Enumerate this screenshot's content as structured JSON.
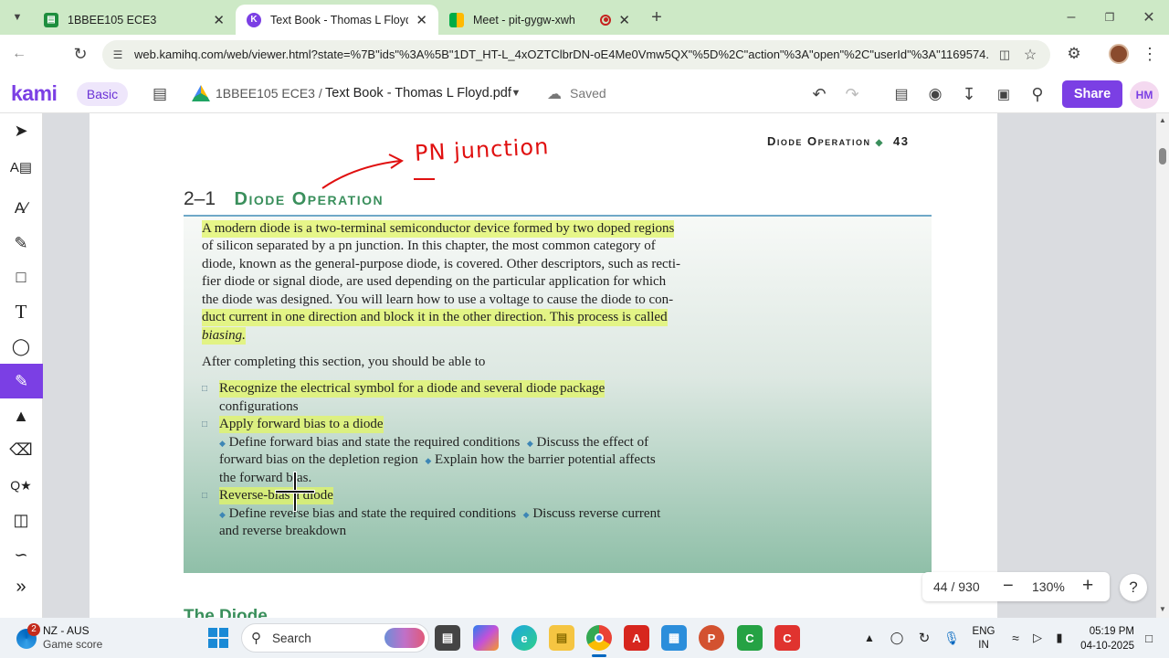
{
  "browser": {
    "tabs": [
      {
        "title": "1BBEE105 ECE3",
        "active": false
      },
      {
        "title": "Text Book - Thomas L Floyd.pdf",
        "active": true
      },
      {
        "title": "Meet - pit-gygw-xwh",
        "active": false
      }
    ],
    "url": "web.kamihq.com/web/viewer.html?state=%7B\"ids\"%3A%5B\"1DT_HT-L_4xOZTClbrDN-oE4Me0Vmw5QX\"%5D%2C\"action\"%3A\"open\"%2C\"userId\"%3A\"1169574..."
  },
  "kami": {
    "logo": "kami",
    "plan": "Basic",
    "folder": "1BBEE105 ECE3 /",
    "filename": "Text Book - Thomas L Floyd.pdf",
    "status": "Saved",
    "share_label": "Share",
    "avatar": "HM"
  },
  "page": {
    "running_head": "Diode Operation",
    "page_num": "43",
    "annotation_top": "PN junction",
    "section_num": "2–1",
    "section_title": "Diode Operation",
    "para": [
      "A modern diode is a two-terminal semiconductor device formed by two doped regions",
      "of silicon separated by a pn junction. In this chapter, the most common category of",
      "diode, known as the general-purpose diode, is covered. Other descriptors, such as recti-",
      "fier diode or signal diode, are used depending on the particular application for which",
      "the diode was designed. You will learn how to use a voltage to cause the diode to con-",
      "duct current in one direction and block it in the other direction. This process is called",
      "biasing."
    ],
    "after": "After completing this section, you should be able to",
    "obj1_a": "Recognize the electrical symbol for a diode and several diode package",
    "obj1_b": "configurations",
    "obj2": "Apply forward bias to a diode",
    "obj2_s1": "Define forward bias and state the required conditions",
    "obj2_s2": "Discuss the effect of",
    "obj2_s3": "forward bias on the depletion region",
    "obj2_s4": "Explain how the barrier potential affects",
    "obj2_s5": "the forward bias.",
    "obj3": "Reverse-bias a diode",
    "obj3_s1": "Define reverse bias and state the required conditions",
    "obj3_s2": "Discuss reverse current",
    "obj3_s3": "and reverse breakdown",
    "next_heading": "The Diode"
  },
  "zoom": {
    "page": "44 / 930",
    "level": "130%",
    "help": "?"
  },
  "taskbar": {
    "badge": "2",
    "weather_line1": "NZ - AUS",
    "weather_line2": "Game score",
    "search": "Search",
    "lang1": "ENG",
    "lang2": "IN",
    "time": "05:19 PM",
    "date": "04-10-2025"
  }
}
